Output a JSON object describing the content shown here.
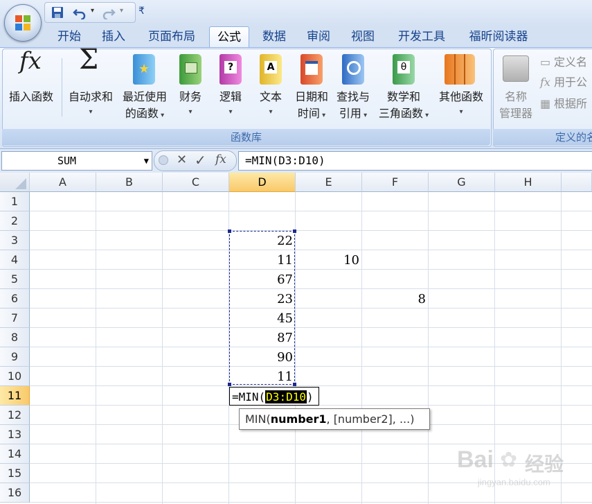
{
  "tabs": [
    "开始",
    "插入",
    "页面布局",
    "公式",
    "数据",
    "审阅",
    "视图",
    "开发工具",
    "福昕阅读器"
  ],
  "active_tab": "公式",
  "ribbon": {
    "buttons": [
      {
        "line1": "插入函数",
        "line2": ""
      },
      {
        "line1": "自动求和",
        "line2": ""
      },
      {
        "line1": "最近使用",
        "line2": "的函数"
      },
      {
        "line1": "财务",
        "line2": ""
      },
      {
        "line1": "逻辑",
        "line2": ""
      },
      {
        "line1": "文本",
        "line2": ""
      },
      {
        "line1": "日期和",
        "line2": "时间"
      },
      {
        "line1": "查找与",
        "line2": "引用"
      },
      {
        "line1": "数学和",
        "line2": "三角函数"
      },
      {
        "line1": "其他函数",
        "line2": ""
      }
    ],
    "group_label": "函数库",
    "names_group": {
      "manager_line1": "名称",
      "manager_line2": "管理器",
      "define_name": "定义名",
      "use_in_formula": "用于公",
      "create_from_selection": "根据所",
      "label": "定义的名"
    }
  },
  "formula_bar": {
    "name_box": "SUM",
    "formula": "=MIN(D3:D10)"
  },
  "columns": [
    "A",
    "B",
    "C",
    "D",
    "E",
    "F",
    "G",
    "H"
  ],
  "selected_column": "D",
  "rows": [
    "1",
    "2",
    "3",
    "4",
    "5",
    "6",
    "7",
    "8",
    "9",
    "10",
    "11",
    "12",
    "13",
    "14",
    "15",
    "16"
  ],
  "selected_row": "11",
  "cells": {
    "D3": "22",
    "D4": "11",
    "D5": "67",
    "D6": "23",
    "D7": "45",
    "D8": "87",
    "D9": "90",
    "D10": "11",
    "E4": "10",
    "F6": "8"
  },
  "edit_cell": {
    "prefix": "=MIN(",
    "range": "D3:D10",
    "suffix": ")"
  },
  "tooltip": {
    "func": "MIN(",
    "arg_bold": "number1",
    "rest": ", [number2], ...)"
  },
  "watermark": {
    "brand": "Bai",
    "brand2": "经验",
    "url": "jingyan.baidu.com"
  },
  "colors": {
    "accent": "#15428b",
    "selected_header": "#f9c96a",
    "range_highlight": "#000000",
    "range_text": "#ffff00"
  }
}
